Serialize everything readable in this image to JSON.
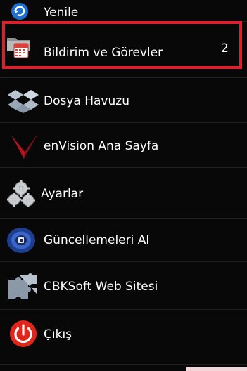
{
  "menu": {
    "items": [
      {
        "label": "Yenile",
        "icon": "refresh-icon"
      },
      {
        "label": "Bildirim ve Görevler",
        "icon": "calendar-folder-icon",
        "badge": "2"
      },
      {
        "label": "Dosya Havuzu",
        "icon": "dropbox-icon"
      },
      {
        "label": "enVision Ana Sayfa",
        "icon": "envision-logo-icon"
      },
      {
        "label": "Ayarlar",
        "icon": "gears-icon"
      },
      {
        "label": "Güncellemeleri Al",
        "icon": "update-disc-icon"
      },
      {
        "label": "CBKSoft Web Sitesi",
        "icon": "puzzle-icon"
      },
      {
        "label": "Çıkış",
        "icon": "power-icon"
      }
    ]
  },
  "colors": {
    "background": "#080808",
    "highlight_border": "#e01e2a",
    "text": "#ffffff"
  }
}
